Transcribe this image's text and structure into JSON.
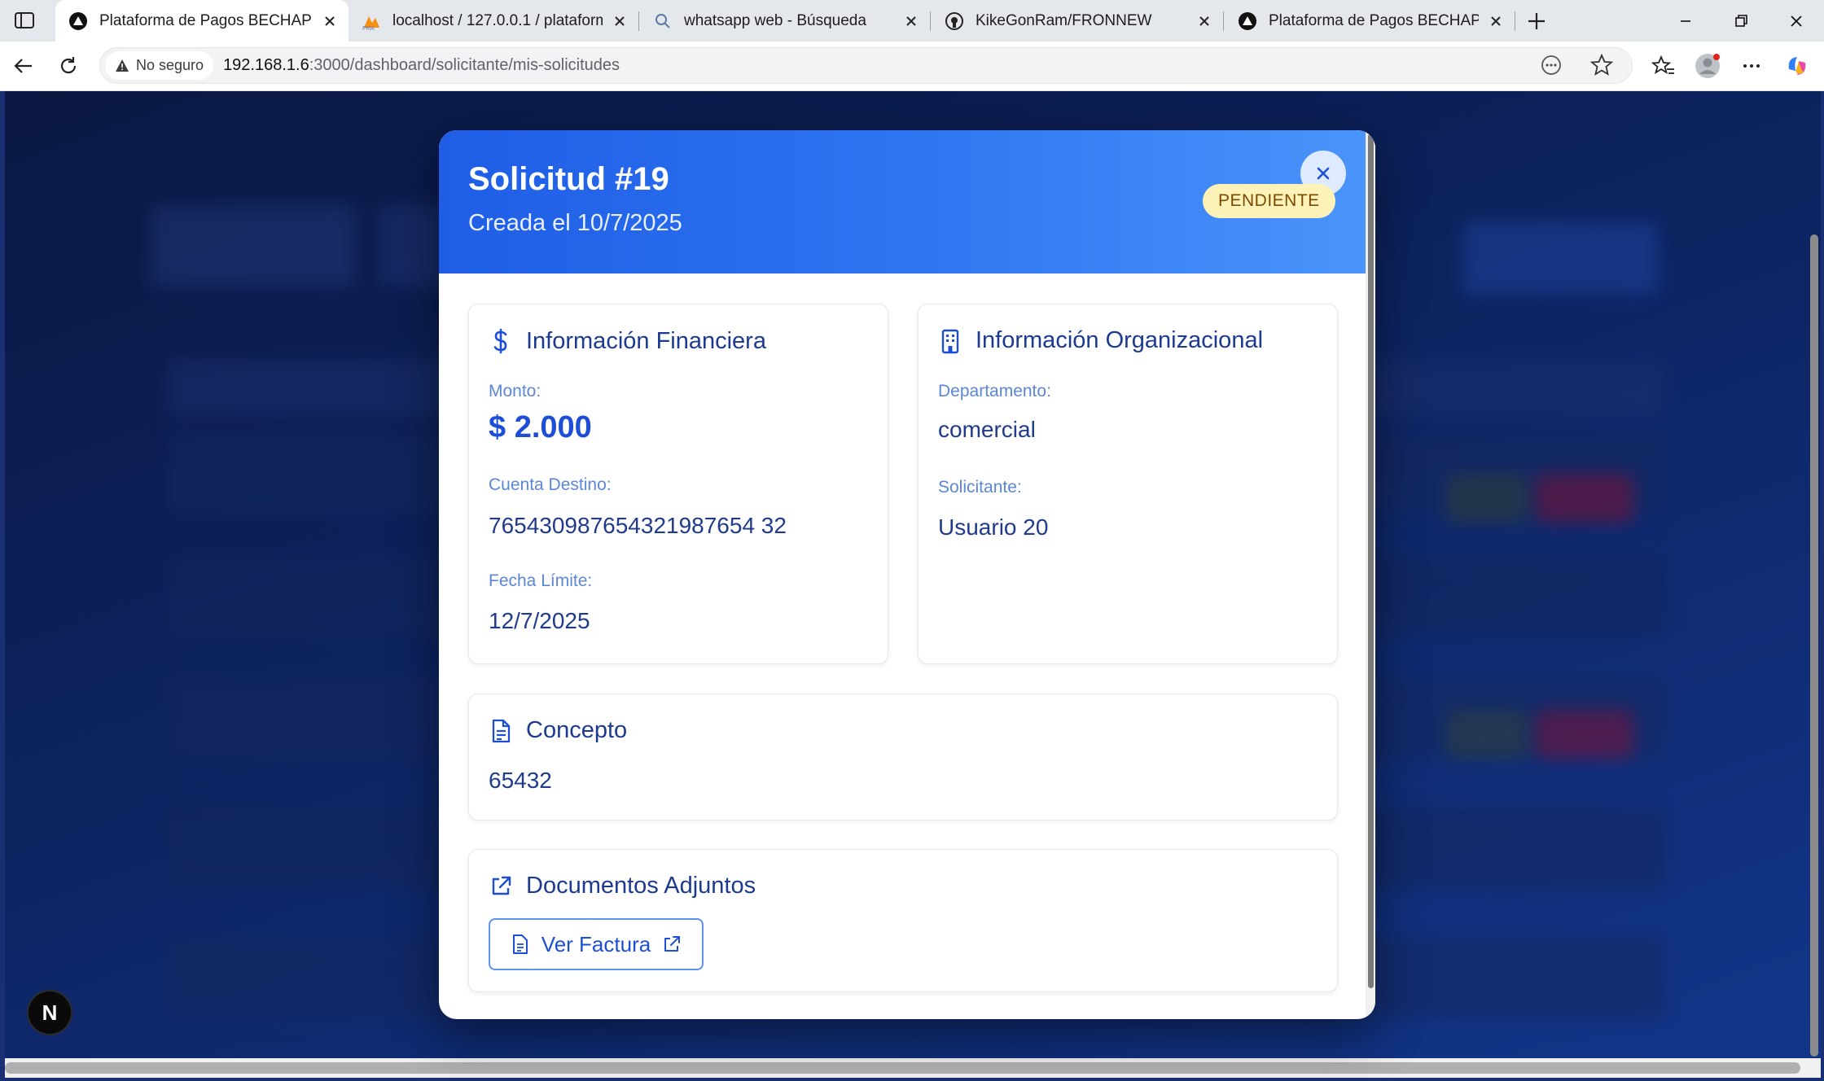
{
  "browser": {
    "tabs": [
      {
        "title": "Plataforma de Pagos BECHAPRA",
        "icon": "triangle-logo-icon",
        "active": true
      },
      {
        "title": "localhost / 127.0.0.1 / plataforma",
        "icon": "phpmyadmin-icon",
        "active": false
      },
      {
        "title": "whatsapp web - Búsqueda",
        "icon": "search-icon",
        "active": false
      },
      {
        "title": "KikeGonRam/FRONNEW",
        "icon": "github-icon",
        "active": false
      },
      {
        "title": "Plataforma de Pagos BECHAPRA",
        "icon": "triangle-logo-icon",
        "active": false
      }
    ],
    "security_label": "No seguro",
    "url_host": "192.168.1.6",
    "url_path": ":3000/dashboard/solicitante/mis-solicitudes"
  },
  "modal": {
    "title": "Solicitud #19",
    "subtitle": "Creada el 10/7/2025",
    "status": "PENDIENTE",
    "financial": {
      "heading": "Información Financiera",
      "amount_label": "Monto:",
      "amount": "$ 2.000",
      "account_label": "Cuenta Destino:",
      "account": "765430987654321987654 32",
      "deadline_label": "Fecha Límite:",
      "deadline": "12/7/2025"
    },
    "organizational": {
      "heading": "Información Organizacional",
      "department_label": "Departamento:",
      "department": "comercial",
      "requester_label": "Solicitante:",
      "requester": "Usuario 20"
    },
    "concept": {
      "heading": "Concepto",
      "value": "65432"
    },
    "documents": {
      "heading": "Documentos Adjuntos",
      "button_label": "Ver Factura"
    }
  },
  "next_badge": "N",
  "colors": {
    "header_start": "#1f5de6",
    "header_end": "#4a94fb",
    "badge_bg": "#fdf3b8",
    "badge_text": "#7a4a05",
    "heading_text": "#1c3a8f",
    "label_text": "#5c86d6",
    "amount_text": "#1d4ed8"
  }
}
